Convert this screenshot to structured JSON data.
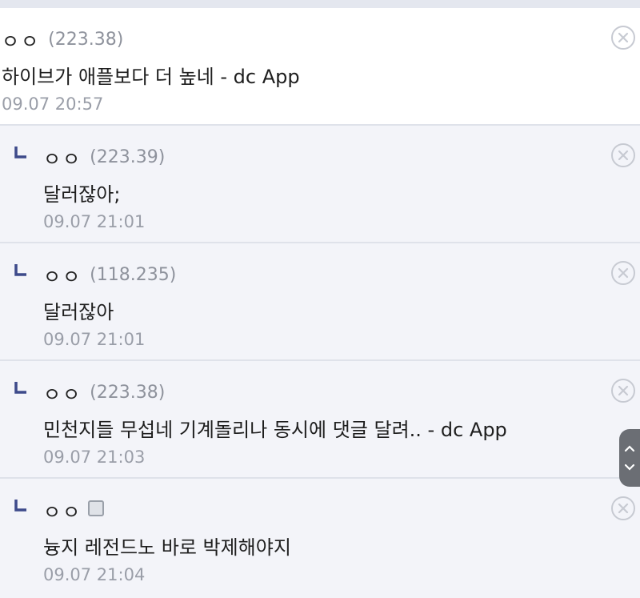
{
  "comments": [
    {
      "nick": "ㅇㅇ",
      "ip": "(223.38)",
      "text": "하이브가 애플보다 더 높네 - dc App",
      "date": "09.07 20:57"
    },
    {
      "nick": "ㅇㅇ",
      "ip": "(223.39)",
      "text": "달러잖아;",
      "date": "09.07 21:01"
    },
    {
      "nick": "ㅇㅇ",
      "ip": "(118.235)",
      "text": "달러잖아",
      "date": "09.07 21:01"
    },
    {
      "nick": "ㅇㅇ",
      "ip": "(223.38)",
      "text": "민천지들 무섭네 기계돌리나 동시에 댓글 달려.. - dc App",
      "date": "09.07 21:03"
    },
    {
      "nick": "ㅇㅇ",
      "ip": "",
      "text": "늉지 레전드노 바로 박제해야지",
      "date": "09.07 21:04"
    }
  ],
  "icons": {
    "close": "close-circle-icon",
    "reply": "reply-arrow-icon",
    "badge": "member-badge-icon",
    "scroll": "scroll-updown-icon"
  },
  "colors": {
    "arrow": "#3d4a8a",
    "close": "#c7cad2",
    "scroll": "#6b6e74"
  }
}
